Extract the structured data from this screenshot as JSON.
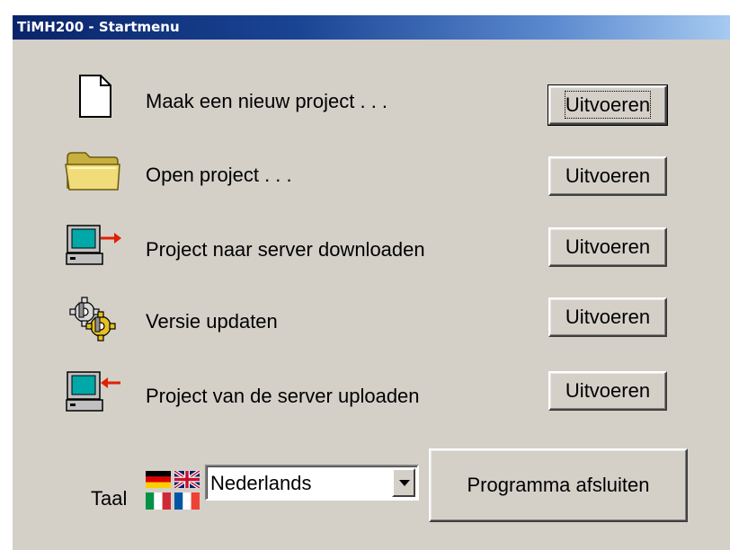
{
  "window": {
    "title": "TiMH200 - Startmenu"
  },
  "rows": [
    {
      "label": "Maak een nieuw project . . .",
      "button": "Uitvoeren",
      "icon": "new-document-icon"
    },
    {
      "label": "Open project  . . .",
      "button": "Uitvoeren",
      "icon": "folder-icon"
    },
    {
      "label": "Project naar server downloaden",
      "button": "Uitvoeren",
      "icon": "computer-download-icon"
    },
    {
      "label": "Versie updaten",
      "button": "Uitvoeren",
      "icon": "gears-icon"
    },
    {
      "label": "Project van de server uploaden",
      "button": "Uitvoeren",
      "icon": "computer-upload-icon"
    }
  ],
  "footer": {
    "language_label": "Taal",
    "language_value": "Nederlands",
    "exit_button": "Programma afsluiten",
    "flags": [
      "german-flag",
      "uk-flag",
      "italian-flag",
      "french-flag"
    ]
  },
  "colors": {
    "window_bg": "#d4d0c8",
    "titlebar_start": "#0a246a",
    "titlebar_end": "#a6caf0",
    "arrow": "#e02000",
    "folder": "#f0dc78"
  }
}
